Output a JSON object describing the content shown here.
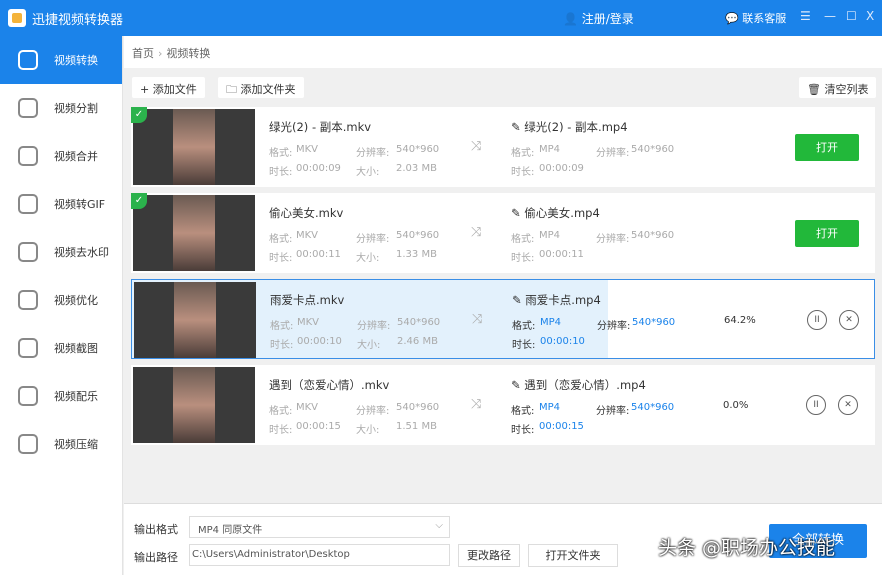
{
  "app": {
    "title": "迅捷视频转换器",
    "login": "注册/登录",
    "support": "联系客服",
    "menu": "☰",
    "min": "—",
    "max": "☐",
    "close": "X"
  },
  "sidebar": {
    "items": [
      {
        "label": "视频转换"
      },
      {
        "label": "视频分割"
      },
      {
        "label": "视频合并"
      },
      {
        "label": "视频转GIF"
      },
      {
        "label": "视频去水印"
      },
      {
        "label": "视频优化"
      },
      {
        "label": "视频截图"
      },
      {
        "label": "视频配乐"
      },
      {
        "label": "视频压缩"
      }
    ]
  },
  "breadcrumb": {
    "home": "首页",
    "sep": "›",
    "current": "视频转换"
  },
  "toolbar": {
    "add_file": "+ 添加文件",
    "add_folder": "🗀 添加文件夹",
    "clear": "🗑 清空列表"
  },
  "labels": {
    "format": "格式:",
    "resolution": "分辨率:",
    "duration": "时长:",
    "size": "大小:",
    "open": "打开"
  },
  "files": [
    {
      "name": "绿光(2) - 副本.mkv",
      "format": "MKV",
      "resolution": "540*960",
      "duration": "00:00:09",
      "size": "2.03 MB",
      "out_name": "绿光(2) - 副本.mp4",
      "out_format": "MP4",
      "out_resolution": "540*960",
      "out_duration": "00:00:09",
      "status": "done"
    },
    {
      "name": "偷心美女.mkv",
      "format": "MKV",
      "resolution": "540*960",
      "duration": "00:00:11",
      "size": "1.33 MB",
      "out_name": "偷心美女.mp4",
      "out_format": "MP4",
      "out_resolution": "540*960",
      "out_duration": "00:00:11",
      "status": "done"
    },
    {
      "name": "雨爱卡点.mkv",
      "format": "MKV",
      "resolution": "540*960",
      "duration": "00:00:10",
      "size": "2.46 MB",
      "out_name": "雨爱卡点.mp4",
      "out_format": "MP4",
      "out_resolution": "540*960",
      "out_duration": "00:00:10",
      "progress": "64.2%",
      "progress_value": 64.2
    },
    {
      "name": "遇到（恋爱心情）.mkv",
      "format": "MKV",
      "resolution": "540*960",
      "duration": "00:00:15",
      "size": "1.51 MB",
      "out_name": "遇到（恋爱心情）.mp4",
      "out_format": "MP4",
      "out_resolution": "540*960",
      "out_duration": "00:00:15",
      "progress": "0.0%",
      "progress_value": 0
    }
  ],
  "bottom": {
    "format_label": "输出格式",
    "format_value": "MP4  同原文件",
    "path_label": "输出路径",
    "path_value": "C:\\Users\\Administrator\\Desktop",
    "change_path": "更改路径",
    "open_folder": "打开文件夹",
    "convert": "全部转换"
  },
  "watermark": "头条 @职场办公技能"
}
